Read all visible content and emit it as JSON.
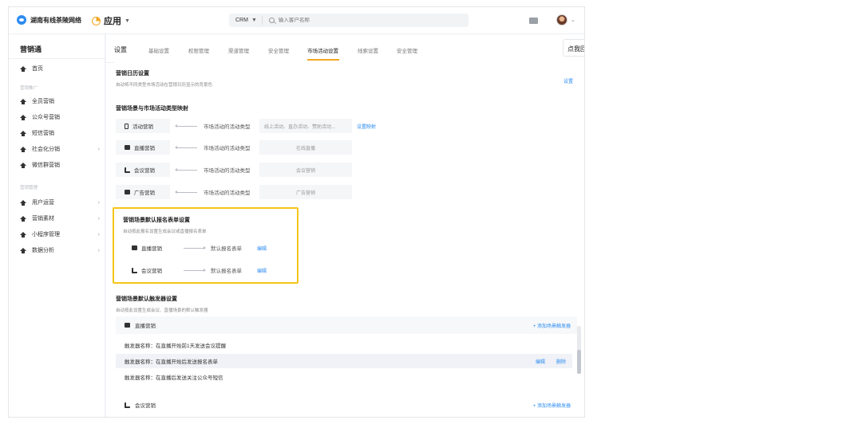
{
  "header": {
    "brand": "湖南有线茶陵网络",
    "app_switch": "应用",
    "search": {
      "scope": "CRM",
      "placeholder": "输入客户名称"
    }
  },
  "sidebar": {
    "title": "营销通",
    "items": [
      {
        "label": "首页",
        "arrow": false
      },
      {
        "label": "全员营销",
        "arrow": false
      },
      {
        "label": "公众号营销",
        "arrow": false
      },
      {
        "label": "短信营销",
        "arrow": false
      },
      {
        "label": "社会化分销",
        "arrow": true
      },
      {
        "label": "微信群营销",
        "arrow": false
      },
      {
        "label": "用户运营",
        "arrow": true
      },
      {
        "label": "营销素材",
        "arrow": true
      },
      {
        "label": "小程序管理",
        "arrow": true
      },
      {
        "label": "数据分析",
        "arrow": true
      }
    ],
    "groups": [
      "营销推广",
      "营销管理"
    ]
  },
  "tabs": {
    "main": "设置",
    "items": [
      "基础设置",
      "权限管理",
      "渠道管理",
      "安全管理",
      "市场活动设置",
      "线索设置",
      "安全管理"
    ],
    "active_index": 4,
    "corner_button": "点我回"
  },
  "calendar": {
    "title": "营销日历设置",
    "desc": "自动将不同类型市场活动在营销日历显示的背景色",
    "link": "设置"
  },
  "mapping": {
    "title": "营销场景与市场活动类型映射",
    "rows": [
      {
        "tag": "活动营销",
        "label": "市场活动的活动类型",
        "value": "线上活动、直办活动、赞助活动...",
        "link": "设置映射"
      },
      {
        "tag": "直播营销",
        "label": "市场活动的活动类型",
        "value": "在线直播",
        "link": ""
      },
      {
        "tag": "会议营销",
        "label": "市场活动的活动类型",
        "value": "会议营销",
        "link": ""
      },
      {
        "tag": "广告营销",
        "label": "市场活动的活动类型",
        "value": "广告营销",
        "link": ""
      }
    ]
  },
  "form_default": {
    "title": "营销场景默认报名表单设置",
    "desc": "自动按此报名设置生成会议或直播报名表单",
    "rows": [
      {
        "tag": "直播营销",
        "label": "默认报名表单",
        "link": "编辑"
      },
      {
        "tag": "会议营销",
        "label": "默认报名表单",
        "link": "编辑"
      }
    ]
  },
  "triggers": {
    "title": "营销场景默认触发器设置",
    "desc": "自动按此设置生成会议、直播场景的默认触发器",
    "groups": [
      {
        "tag": "直播营销",
        "add": "添加场景触发器",
        "rows": [
          "触发器名称：在直播开始前1天发送会议提醒",
          "触发器名称：在直播开始后发送报名表单",
          "触发器名称：在直播后发送关注公众号短信"
        ]
      },
      {
        "tag": "会议营销",
        "add": "添加场景触发器",
        "rows": []
      }
    ],
    "row_actions": {
      "edit": "编辑",
      "delete": "删除"
    }
  },
  "colors": {
    "accent": "#2d8cf0",
    "tab_active": "#f5a623",
    "highlight": "#f5c518"
  }
}
